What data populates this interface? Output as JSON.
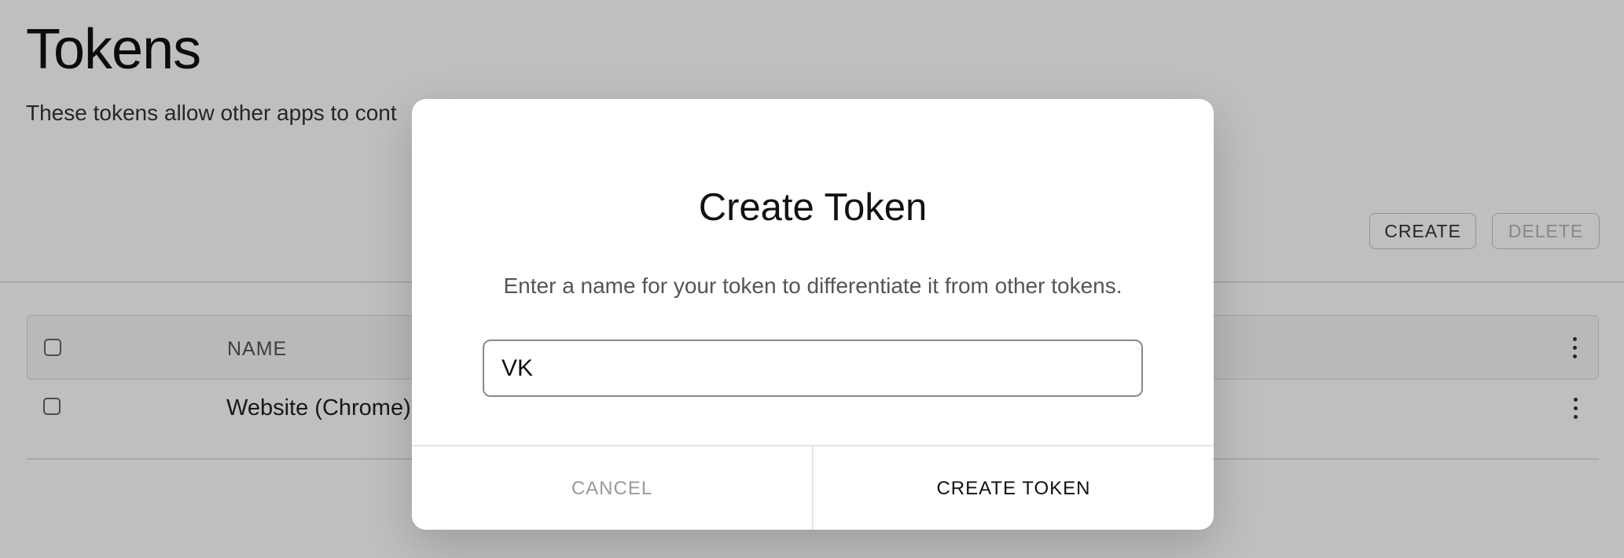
{
  "page": {
    "title": "Tokens",
    "description": "These tokens allow other apps to cont"
  },
  "toolbar": {
    "create_label": "CREATE",
    "delete_label": "DELETE"
  },
  "table": {
    "columns": [
      "NAME"
    ],
    "rows": [
      {
        "name": "Website (Chrome)"
      }
    ]
  },
  "dialog": {
    "title": "Create Token",
    "description": "Enter a name for your token to differentiate it from other tokens.",
    "input_value": "VK",
    "cancel_label": "CANCEL",
    "confirm_label": "CREATE TOKEN"
  }
}
